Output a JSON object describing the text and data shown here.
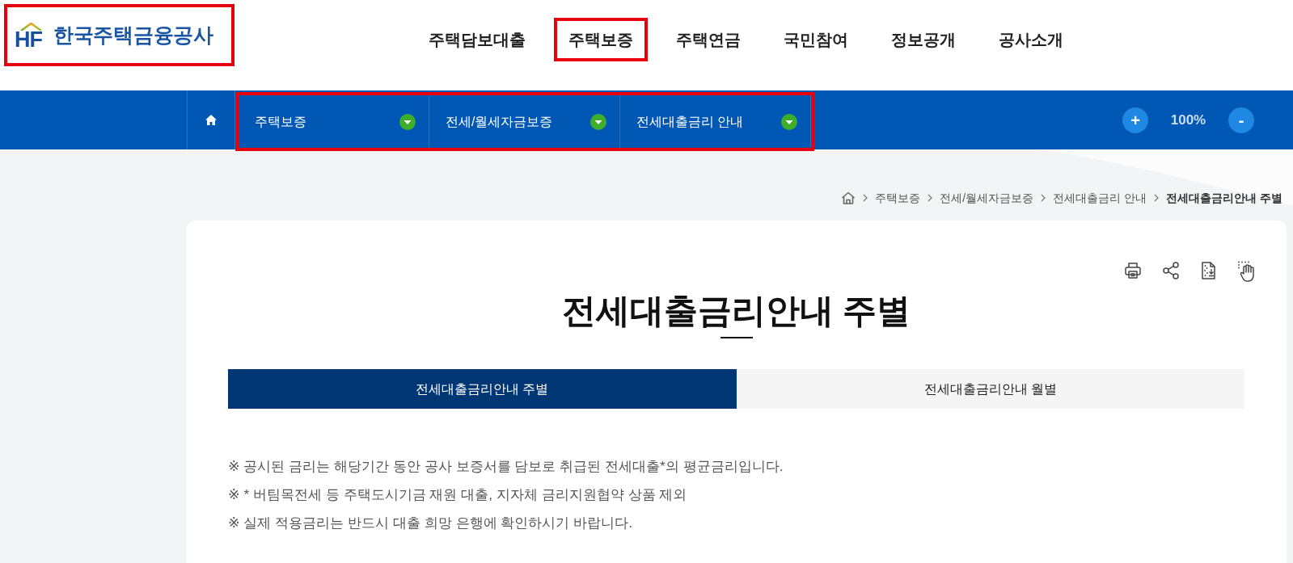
{
  "header": {
    "logo": {
      "mark": "HF",
      "name": "한국주택금융공사",
      "highlighted": true
    },
    "menu": [
      {
        "label": "주택담보대출",
        "highlighted": false
      },
      {
        "label": "주택보증",
        "highlighted": true
      },
      {
        "label": "주택연금",
        "highlighted": false
      },
      {
        "label": "국민참여",
        "highlighted": false
      },
      {
        "label": "정보공개",
        "highlighted": false
      },
      {
        "label": "공사소개",
        "highlighted": false
      }
    ]
  },
  "location_bar": {
    "highlighted": true,
    "items": [
      {
        "label": "주택보증"
      },
      {
        "label": "전세/월세자금보증"
      },
      {
        "label": "전세대출금리 안내"
      }
    ],
    "zoom_in": "+",
    "zoom_level": "100%",
    "zoom_out": "-"
  },
  "breadcrumb": [
    {
      "label": "주택보증",
      "current": false
    },
    {
      "label": "전세/월세자금보증",
      "current": false
    },
    {
      "label": "전세대출금리 안내",
      "current": false
    },
    {
      "label": "전세대출금리안내 주별",
      "current": true
    }
  ],
  "content": {
    "title": "전세대출금리안내 주별",
    "tabs": [
      {
        "label": "전세대출금리안내 주별",
        "selected": true
      },
      {
        "label": "전세대출금리안내 월별",
        "selected": false
      }
    ],
    "notes": [
      "※ 공시된 금리는 해당기간 동안 공사 보증서를 담보로 취급된 전세대출*의 평균금리입니다.",
      "※ * 버팀목전세 등 주택도시기금 재원 대출, 지자체 금리지원협약 상품 제외",
      "※ 실제 적용금리는 반드시 대출 희망 은행에 확인하시기 바랍니다."
    ]
  }
}
